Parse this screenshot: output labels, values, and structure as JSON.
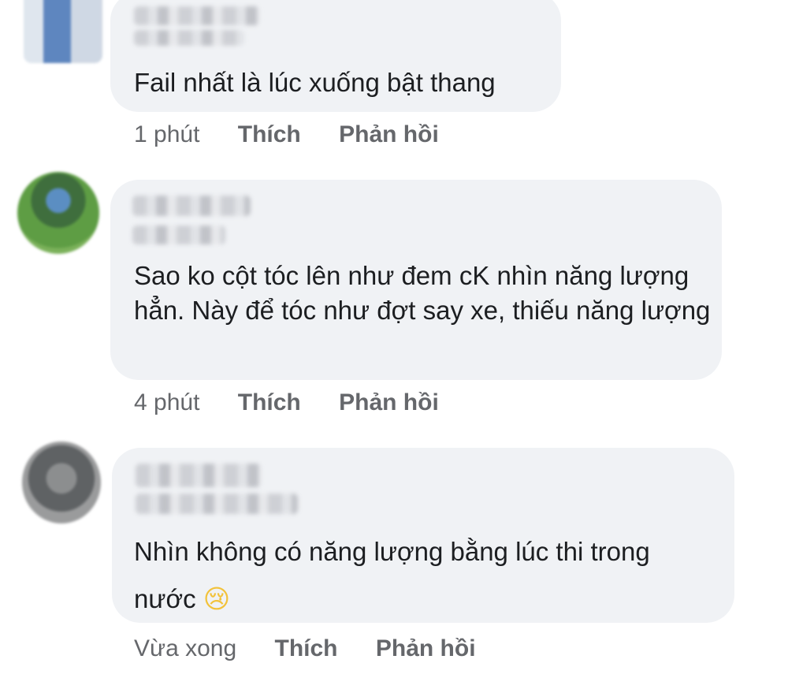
{
  "comments": [
    {
      "text": "Fail nhất là lúc xuống bật thang",
      "time": "1 phút",
      "like": "Thích",
      "reply": "Phản hồi"
    },
    {
      "text": "Sao ko cột tóc lên như đem cK nhìn năng lượng hẳn. Này để tóc như đợt say xe, thiếu năng lượng",
      "time": "4 phút",
      "like": "Thích",
      "reply": "Phản hồi"
    },
    {
      "text": "Nhìn không có năng lượng bằng lúc thi trong nước",
      "emoji": "😢",
      "time": "Vừa xong",
      "like": "Thích",
      "reply": "Phản hồi"
    }
  ]
}
